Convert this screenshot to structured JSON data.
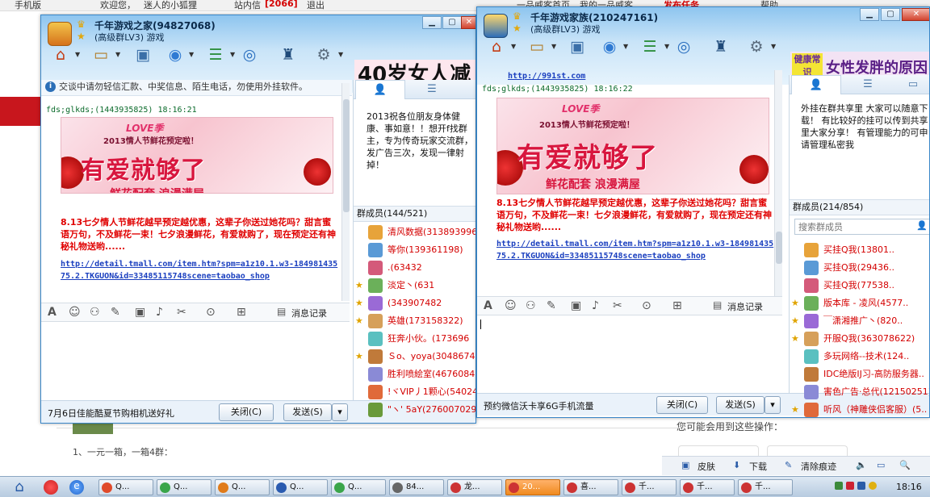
{
  "browser": {
    "topbar": {
      "mobile": "手机版",
      "welcome": "欢迎您，",
      "user": "迷人的小狐狸",
      "mail_label": "站内信",
      "mail_count": "[2066]",
      "logout": "退出",
      "snippet1": "一品威客首页",
      "snippet2": "我的一品威客",
      "post_task": "发布任务",
      "help": "帮助"
    },
    "bottom_hint": "您可能会用到这些操作：",
    "list_line": "1、一元一箱，一箱4群：",
    "sharebar": {
      "skin": "皮肤",
      "download": "下载",
      "clear": "清除痕迹"
    }
  },
  "window1": {
    "title": "千年游戏之家(94827068)",
    "subtitle": "(高级群LV3) 游戏",
    "ad": "40岁女人减",
    "notice": "交谈中请勿轻信汇款、中奖信息、陌生电话，勿使用外挂软件。",
    "sender": "fds;glkds;(1443935825)  18:16:21",
    "promo": {
      "love": "LOVE季",
      "title": "2013情人节鲜花预定啦！",
      "big": "有爱就够了",
      "sub": "鲜花配套 浪漫满屋"
    },
    "message": "8.13七夕情人节鲜花越早预定越优惠，这辈子你送过她花吗？甜言蜜语万句，不及鲜花一束！七夕浪漫鲜花，有爱就购了，现在预定还有神秘礼物送哟......",
    "link": "http://detail.tmall.com/item.htm?spm=a1z10.1.w3-18498143575.2.TKGUON&id=33485115748scene=taobao_shop",
    "msg_record": "消息记录",
    "footer_text": "7月6日佳能酷夏节购相机送好礼",
    "close_btn": "关闭(C)",
    "send_btn": "发送(S)",
    "announcement": "2013祝各位朋友身体健康、事如意！！想开f找群主，专为传奇玩家交流群，发广告三次，发现一律射掉！",
    "members_header": "群成员(144/521)",
    "members": [
      {
        "name": "清风数据(313893996)",
        "color": "#d40000",
        "star": false
      },
      {
        "name": "等你(139361198)",
        "color": "#d40000",
        "star": false
      },
      {
        "name": ".(63432",
        "color": "#d40000",
        "star": false
      },
      {
        "name": "淡定丶(631",
        "color": "#d40000",
        "star": true
      },
      {
        "name": "(343907482",
        "color": "#d40000",
        "star": true
      },
      {
        "name": "英雄(173158322)",
        "color": "#d40000",
        "star": true
      },
      {
        "name": "狂奔小伙。(173696",
        "color": "#d40000",
        "star": false
      },
      {
        "name": "Ｓo、yoya(3048674",
        "color": "#d40000",
        "star": true
      },
      {
        "name": "胜利喷絵室(4676084",
        "color": "#d40000",
        "star": false
      },
      {
        "name": "!ヾVIP丿1颗心(54024",
        "color": "#d40000",
        "star": false
      },
      {
        "name": "\"ヽ' 5aY(276007029",
        "color": "#d40000",
        "star": false
      }
    ]
  },
  "window2": {
    "title": "千年游戏家族(210247161)",
    "subtitle": "(高级群LV3) 游戏",
    "ad_badge": "健康常识",
    "ad": "女性发胖的原因",
    "prev_link": "http://991st.com",
    "sender": "fds;glkds;(1443935825)  18:16:22",
    "promo": {
      "love": "LOVE季",
      "title": "2013情人节鲜花预定啦！",
      "big": "有爱就够了",
      "sub": "鲜花配套 浪漫满屋"
    },
    "message": "8.13七夕情人节鲜花越早预定越优惠，这辈子你送过她花吗？甜言蜜语万句，不及鲜花一束！七夕浪漫鲜花，有爱就购了，现在预定还有神秘礼物送哟......",
    "link": "http://detail.tmall.com/item.htm?spm=a1z10.1.w3-18498143575.2.TKGUON&id=33485115748scene=taobao_shop",
    "msg_record": "消息记录",
    "footer_text": "预约微信沃卡享6G手机流量",
    "close_btn": "关闭(C)",
    "send_btn": "发送(S)",
    "announcement": "外挂在群共享里 大家可以随意下载！ 有比较好的挂可以传到共享里大家分享！ 有管理能力的可申请管理私密我",
    "members_header": "群成员(214/854)",
    "search_placeholder": "搜索群成员",
    "members": [
      {
        "name": "买挂Q我(13801..",
        "color": "#d40000",
        "star": false
      },
      {
        "name": "买挂Q我(29436..",
        "color": "#d40000",
        "star": false
      },
      {
        "name": "买挂Q我(77538..",
        "color": "#d40000",
        "star": false
      },
      {
        "name": "版本库 - 凌风(4577..",
        "color": "#d40000",
        "star": true
      },
      {
        "name": "￣潇湘推广丶(820..",
        "color": "#d40000",
        "star": true
      },
      {
        "name": "开服Q我(363078622)",
        "color": "#d40000",
        "star": true
      },
      {
        "name": "多玩网络--技术(124..",
        "color": "#d40000",
        "star": false
      },
      {
        "name": "IDC绝版IJ习-高防服务器..",
        "color": "#d40000",
        "star": false
      },
      {
        "name": "害色广告·总代(12150251)",
        "color": "#d40000",
        "star": false
      },
      {
        "name": "听风（神雕侠侣客服）(5..",
        "color": "#d40000",
        "star": true
      }
    ]
  },
  "taskbar": {
    "items": [
      {
        "label": "Q...",
        "color": "#e04a2a"
      },
      {
        "label": "Q...",
        "color": "#3aa54a"
      },
      {
        "label": "Q...",
        "color": "#e07b1a"
      },
      {
        "label": "Q...",
        "color": "#2a5bb0"
      },
      {
        "label": "Q...",
        "color": "#3aa54a"
      },
      {
        "label": "84...",
        "color": "#666666"
      },
      {
        "label": "龙...",
        "color": "#c33"
      },
      {
        "label": "20...",
        "color": "#c33"
      },
      {
        "label": "喜...",
        "color": "#c33"
      },
      {
        "label": "千...",
        "color": "#c33"
      },
      {
        "label": "千...",
        "color": "#c33"
      },
      {
        "label": "千...",
        "color": "#c33"
      }
    ],
    "clock": "18:16"
  }
}
